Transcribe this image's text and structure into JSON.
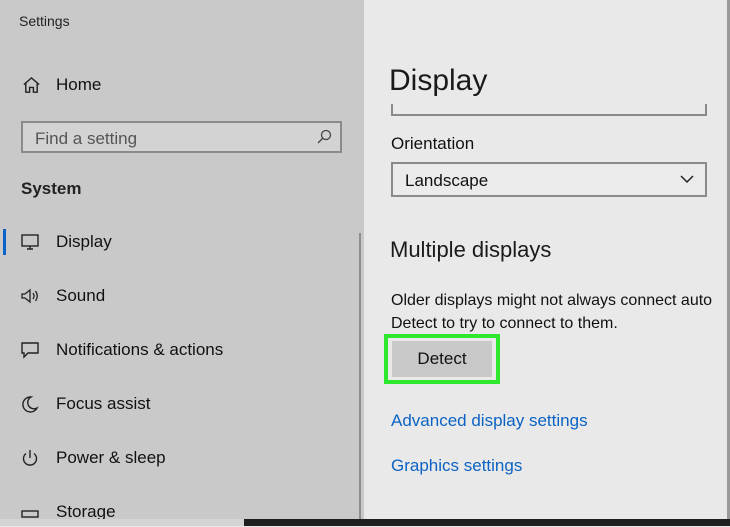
{
  "window": {
    "title": "Settings"
  },
  "sidebar": {
    "home_label": "Home",
    "search_placeholder": "Find a setting",
    "section_label": "System",
    "items": [
      {
        "label": "Display",
        "icon": "monitor-icon",
        "active": true
      },
      {
        "label": "Sound",
        "icon": "speaker-icon"
      },
      {
        "label": "Notifications & actions",
        "icon": "message-icon"
      },
      {
        "label": "Focus assist",
        "icon": "moon-icon"
      },
      {
        "label": "Power & sleep",
        "icon": "power-icon"
      },
      {
        "label": "Storage",
        "icon": "storage-icon"
      }
    ]
  },
  "main": {
    "title": "Display",
    "orientation_label": "Orientation",
    "orientation_value": "Landscape",
    "multiple_heading": "Multiple displays",
    "multiple_desc_line1": "Older displays might not always connect auto",
    "multiple_desc_line2": "Detect to try to connect to them.",
    "detect_label": "Detect",
    "advanced_link": "Advanced display settings",
    "graphics_link": "Graphics settings"
  },
  "colors": {
    "accent": "#0a64c8",
    "link": "#0b63c4",
    "highlight": "#2ee82e"
  }
}
